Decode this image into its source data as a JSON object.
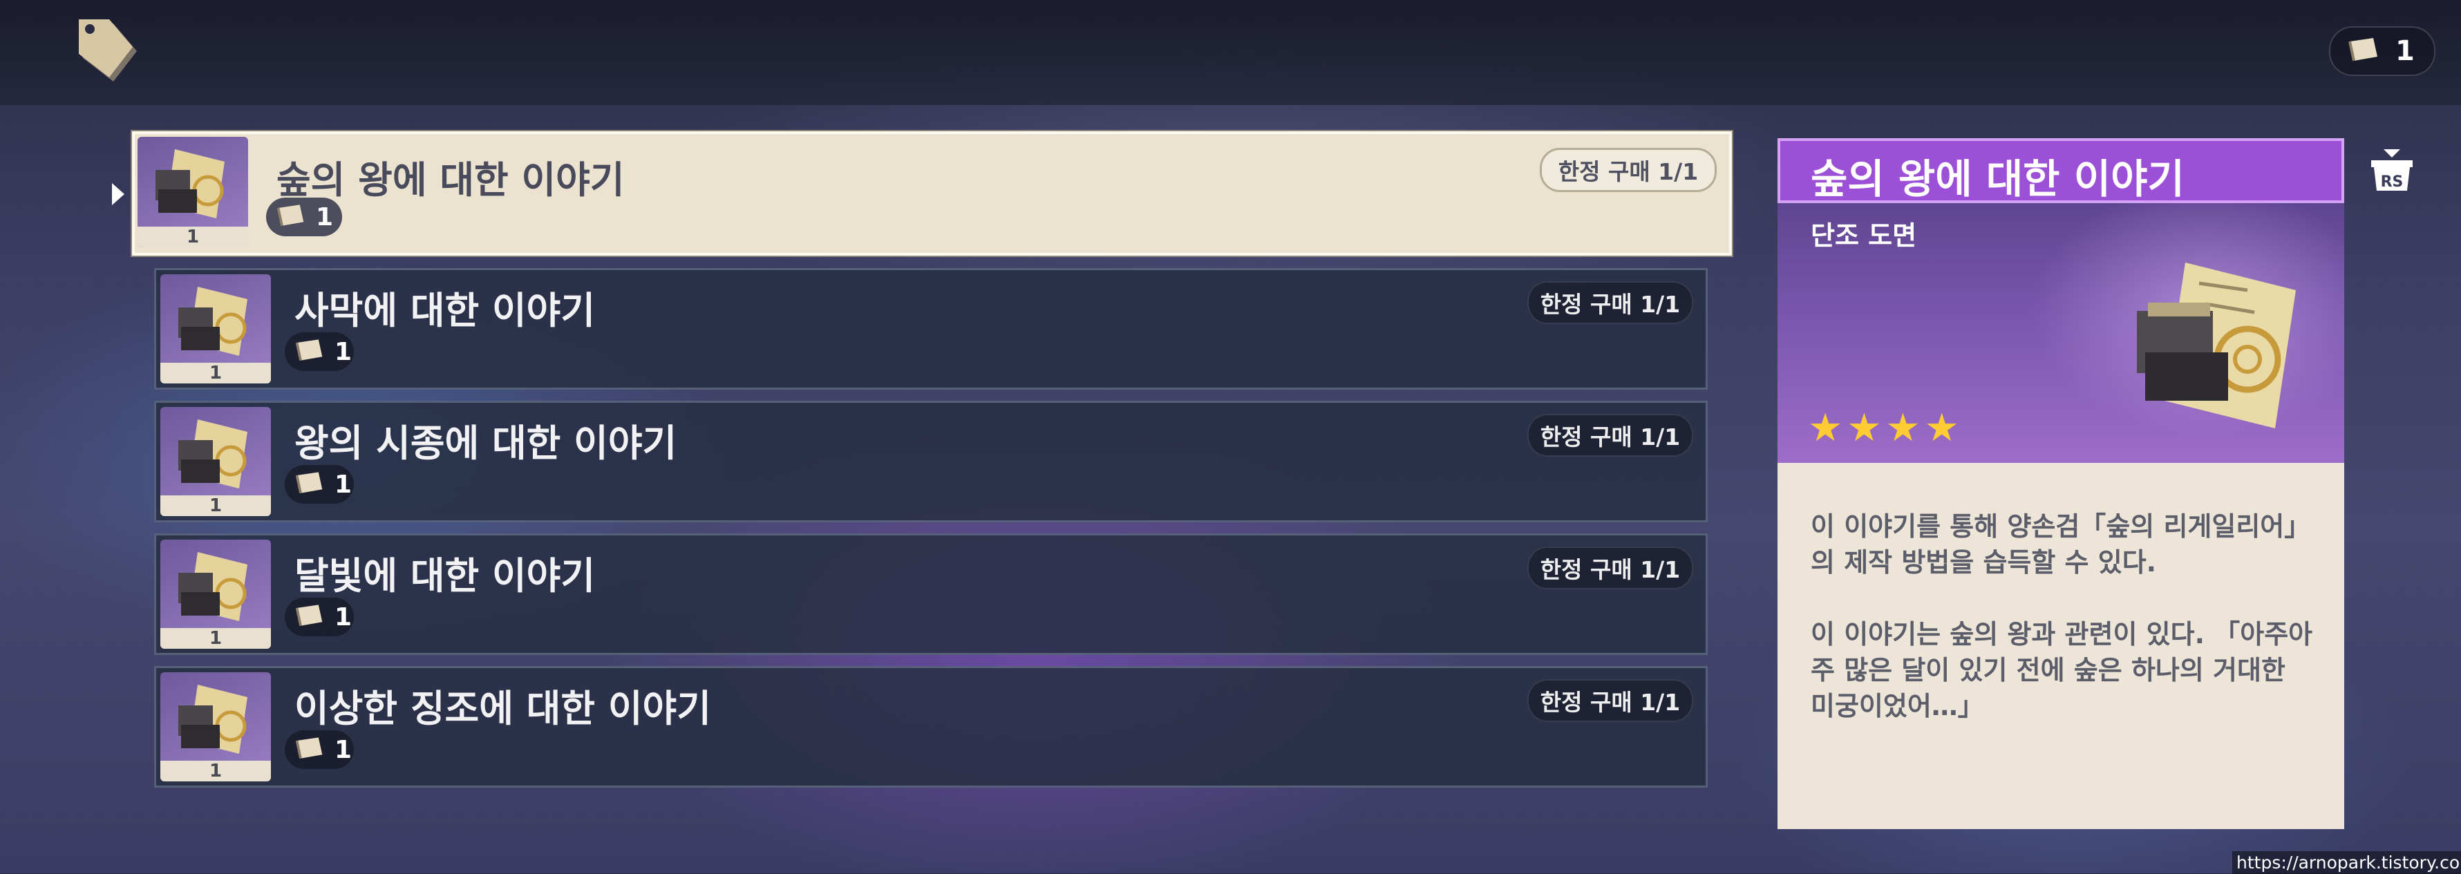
{
  "topbar": {
    "shop_icon": "price-tag-icon",
    "currency": {
      "icon": "paper-scroll-icon",
      "value": "1"
    }
  },
  "items": [
    {
      "title": "숲의 왕에 대한 이야기",
      "price": "1",
      "limit": "한정 구매 1/1",
      "qty": "1",
      "selected": true
    },
    {
      "title": "사막에 대한 이야기",
      "price": "1",
      "limit": "한정 구매 1/1",
      "qty": "1",
      "selected": false
    },
    {
      "title": "왕의 시종에 대한 이야기",
      "price": "1",
      "limit": "한정 구매 1/1",
      "qty": "1",
      "selected": false
    },
    {
      "title": "달빛에 대한 이야기",
      "price": "1",
      "limit": "한정 구매 1/1",
      "qty": "1",
      "selected": false
    },
    {
      "title": "이상한 징조에 대한 이야기",
      "price": "1",
      "limit": "한정 구매 1/1",
      "qty": "1",
      "selected": false
    }
  ],
  "detail": {
    "title": "숲의 왕에 대한 이야기",
    "type": "단조 도면",
    "rarity": 4,
    "stars": [
      "★",
      "★",
      "★",
      "★"
    ],
    "description": [
      "이 이야기를 통해 양손검「숲의 리게일리어」의 제작 방법을 습득할 수 있다.",
      "이 이야기는 숲의 왕과 관련이 있다. 「아주아주 많은 달이 있기 전에 숲은 하나의 거대한 미궁이었어…」"
    ]
  },
  "side_icon": "rs-redeem-icon",
  "watermark": "https://arnopark.tistory.com",
  "colors": {
    "selected_row_bg": "#ebe2cf",
    "row_bg": "#282e44",
    "detail_title_bg": "#9c4fd7",
    "star": "#ffcc33",
    "detail_body_bg": "#ece5d8"
  }
}
